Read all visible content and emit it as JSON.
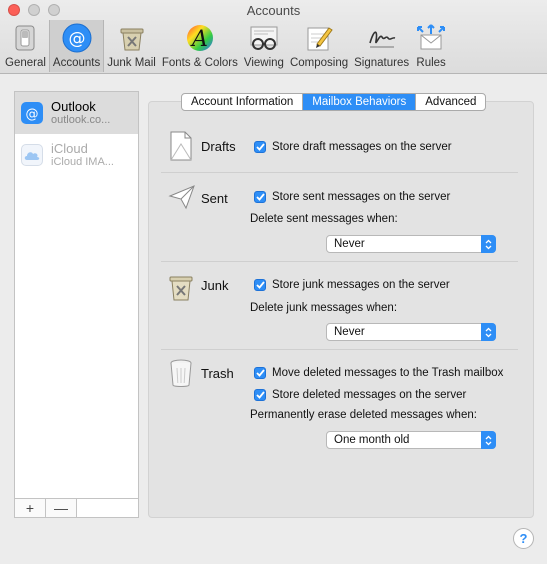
{
  "window": {
    "title": "Accounts"
  },
  "toolbar": {
    "tabs": [
      {
        "label": "General",
        "icon": "switch-icon"
      },
      {
        "label": "Accounts",
        "icon": "at-sign-icon"
      },
      {
        "label": "Junk Mail",
        "icon": "trash-can-icon"
      },
      {
        "label": "Fonts & Colors",
        "icon": "font-palette-icon"
      },
      {
        "label": "Viewing",
        "icon": "glasses-icon"
      },
      {
        "label": "Composing",
        "icon": "pencil-paper-icon"
      },
      {
        "label": "Signatures",
        "icon": "signature-icon"
      },
      {
        "label": "Rules",
        "icon": "envelope-arrows-icon"
      }
    ],
    "active_tab": "Accounts"
  },
  "sidebar": {
    "accounts": [
      {
        "name": "Outlook",
        "detail": "outlook.co...",
        "selected": true
      },
      {
        "name": "iCloud",
        "detail": "iCloud IMA...",
        "selected": false
      }
    ],
    "add_label": "+",
    "remove_label": "—"
  },
  "segments": [
    "Account Information",
    "Mailbox Behaviors",
    "Advanced"
  ],
  "active_segment": "Mailbox Behaviors",
  "drafts": {
    "title": "Drafts",
    "store_label": "Store draft messages on the server",
    "store_checked": true
  },
  "sent": {
    "title": "Sent",
    "store_label": "Store sent messages on the server",
    "store_checked": true,
    "delete_label": "Delete sent messages when:",
    "delete_value": "Never"
  },
  "junk": {
    "title": "Junk",
    "store_label": "Store junk messages on the server",
    "store_checked": true,
    "delete_label": "Delete junk messages when:",
    "delete_value": "Never"
  },
  "trash": {
    "title": "Trash",
    "move_label": "Move deleted messages to the Trash mailbox",
    "move_checked": true,
    "store_label": "Store deleted messages on the server",
    "store_checked": true,
    "erase_label": "Permanently erase deleted messages when:",
    "erase_value": "One month old"
  },
  "help_label": "?",
  "colors": {
    "accent": "#2e8ef6",
    "close": "#fc5f57"
  }
}
